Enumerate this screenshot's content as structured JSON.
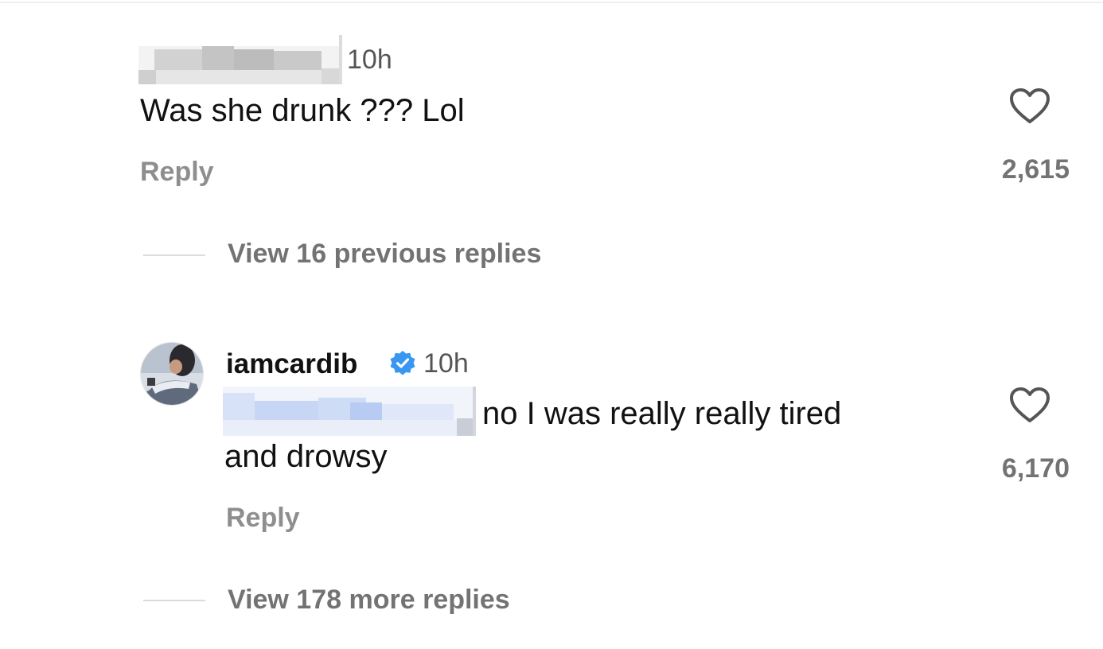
{
  "comments": [
    {
      "timestamp": "10h",
      "text": "Was she drunk ??? Lol",
      "reply_label": "Reply",
      "like_count": "2,615"
    },
    {
      "username": "iamcardib",
      "verified": true,
      "timestamp": "10h",
      "text_line1": "no I was really really tired",
      "text_line2": "and drowsy",
      "reply_label": "Reply",
      "like_count": "6,170"
    }
  ],
  "threads": {
    "previous_replies_label": "View 16 previous replies",
    "more_replies_label": "View 178 more replies"
  },
  "icons": {
    "like": "heart-outline-icon",
    "verified": "verified-badge-icon"
  },
  "colors": {
    "text_primary": "#111111",
    "text_secondary": "#737373",
    "verified_blue": "#0095f6"
  }
}
